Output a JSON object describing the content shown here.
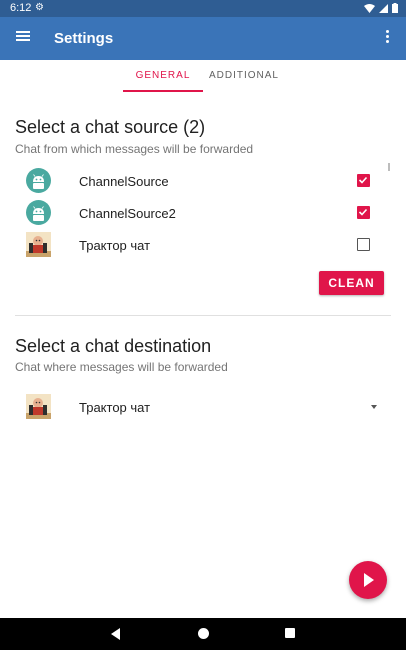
{
  "status_bar": {
    "time": "6:12"
  },
  "app_bar": {
    "title": "Settings"
  },
  "tabs": [
    {
      "label": "GENERAL",
      "selected": true
    },
    {
      "label": "ADDITIONAL",
      "selected": false
    }
  ],
  "source": {
    "title": "Select a chat source (2)",
    "subtitle": "Chat from which messages will be forwarded",
    "items": [
      {
        "label": "ChannelSource",
        "avatar": "android-icon",
        "checked": true
      },
      {
        "label": "ChannelSource2",
        "avatar": "android-icon",
        "checked": true
      },
      {
        "label": "Трактор чат",
        "avatar": "tractor-chat-avatar",
        "checked": false
      }
    ],
    "clean_label": "CLEAN"
  },
  "destination": {
    "title": "Select a chat destination",
    "subtitle": "Chat where messages will be forwarded",
    "selected": {
      "label": "Трактор чат",
      "avatar": "tractor-chat-avatar"
    }
  },
  "colors": {
    "primary": "#3a74b8",
    "primary_dark": "#2f5d93",
    "accent": "#e0154a"
  }
}
